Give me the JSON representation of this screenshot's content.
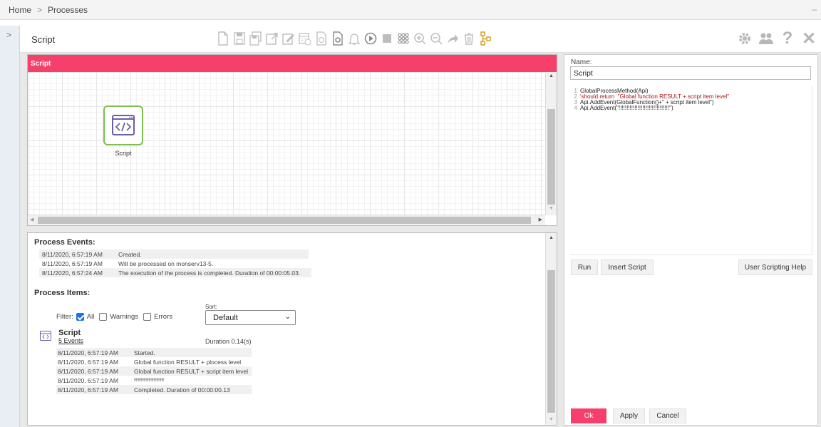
{
  "breadcrumb": {
    "home": "Home",
    "separator": ">",
    "current": "Processes",
    "collapse": "–"
  },
  "sidebar": {
    "expand_chevron": ">"
  },
  "toolbar": {
    "title": "Script",
    "icons": [
      "new-document-icon",
      "save-icon",
      "save-as-icon",
      "export-icon",
      "edit-icon",
      "schedule-icon",
      "script-icon",
      "settings-icon",
      "notification-bell-icon",
      "run-icon",
      "stop-icon",
      "grid-icon",
      "zoom-in-icon",
      "zoom-out-icon",
      "share-icon",
      "delete-icon",
      "hierarchy-icon"
    ],
    "right_icons": [
      "gear-icon",
      "users-icon",
      "help-icon",
      "close-icon"
    ],
    "help_glyph": "?",
    "close_glyph": "✕"
  },
  "diagram": {
    "header": "Script",
    "node_label": "Script"
  },
  "events": {
    "title": "Process Events:",
    "rows": [
      {
        "time": "8/11/2020, 6:57:19 AM",
        "text": "Created."
      },
      {
        "time": "8/11/2020, 6:57:19 AM",
        "text": "Will be processed on monserv13-5."
      },
      {
        "time": "8/11/2020, 6:57:24 AM",
        "text": "The execution of the process is completed. Duration of 00:00:05.03."
      }
    ]
  },
  "items": {
    "title": "Process Items:",
    "filter_label": "Filter:",
    "filter_all": "All",
    "filter_warnings": "Warnings",
    "filter_errors": "Errors",
    "sort_label": "Sort:",
    "sort_value": "Default",
    "item_name": "Script",
    "item_events_link": "5 Events",
    "item_duration": "Duration 0.14(s)",
    "rows": [
      {
        "time": "8/11/2020, 6:57:19 AM",
        "text": "Started."
      },
      {
        "time": "8/11/2020, 6:57:19 AM",
        "text": "Global function RESULT + pl​ocess level"
      },
      {
        "time": "8/11/2020, 6:57:19 AM",
        "text": "Global function RESULT + script item level"
      },
      {
        "time": "8/11/2020, 6:57:19 AM",
        "text": "!!!!!!!!!!!!!!!!!!!!!!!!!!!!!!!"
      },
      {
        "time": "8/11/2020, 6:57:19 AM",
        "text": "Completed. Duration of 00:00:00.13"
      }
    ]
  },
  "properties": {
    "name_label": "Name:",
    "name_value": "Script",
    "code": [
      {
        "n": "1",
        "text": "GlobalProcessMethod(Api)",
        "kind": "code"
      },
      {
        "n": "2",
        "text": "'should return  \"Global function RESULT + script item level\"",
        "kind": "string"
      },
      {
        "n": "3",
        "text": "Api.AddEvent(GlobalFunction()+\" + script item level\")",
        "kind": "code"
      },
      {
        "n": "4",
        "text": "Api.AddEvent(\"!!!!!!!!!!!!!!!!!!!!!!!!!!!!!!!!\")",
        "kind": "code"
      }
    ],
    "run_label": "Run",
    "insert_label": "Insert Script",
    "help_label": "User Scripting Help",
    "ok_label": "Ok",
    "apply_label": "Apply",
    "cancel_label": "Cancel"
  },
  "colors": {
    "accent": "#f73f6b",
    "node_border": "#7cbf4a",
    "icon_purple": "#6b5fa8"
  }
}
